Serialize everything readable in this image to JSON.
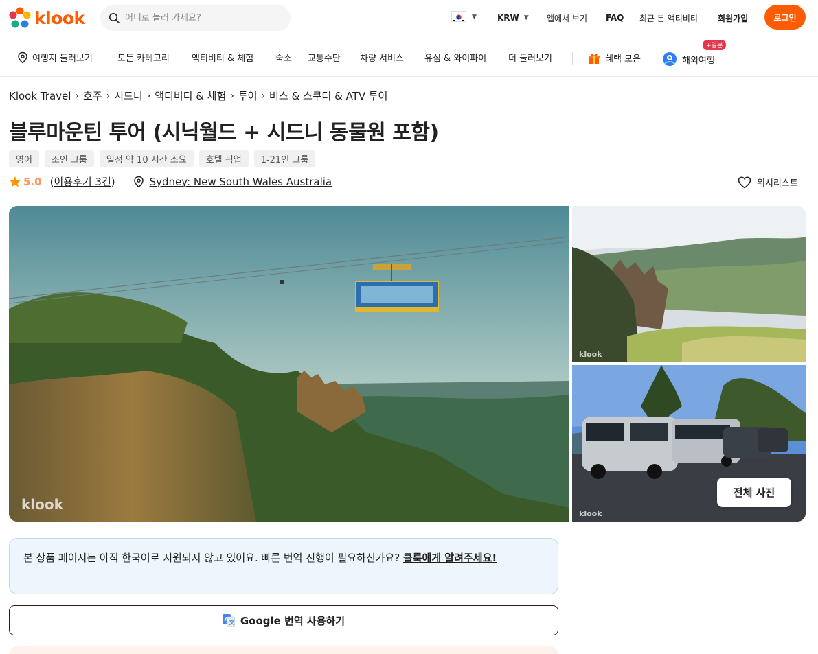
{
  "header": {
    "logo_text": "klook",
    "search_placeholder": "어디로 놀러 가세요?",
    "currency": "KRW",
    "app_view": "앱에서 보기",
    "faq": "FAQ",
    "recent": "최근 본 액티비티",
    "signup": "회원가입",
    "login": "로그인"
  },
  "nav": {
    "items": [
      "여행지 둘러보기",
      "모든 카테고리",
      "액티비티 & 체험",
      "숙소",
      "교통수단",
      "차량 서비스",
      "유심 & 와이파이",
      "더 둘러보기"
    ],
    "benefits": "혜택 모음",
    "overseas": "해외여행",
    "overseas_badge": "+일본"
  },
  "breadcrumb": [
    "Klook Travel",
    "호주",
    "시드니",
    "액티비티 & 체험",
    "투어",
    "버스 & 스쿠터 & ATV 투어"
  ],
  "title": "블루마운틴 투어 (시닉월드 + 시드니 동물원 포함)",
  "tags": [
    "영어",
    "조인 그룹",
    "일정 약 10 시간  소요",
    "호텔 픽업",
    "1-21인 그룹"
  ],
  "rating": {
    "value": "5.0",
    "reviews_open": "(",
    "reviews": "이용후기 3건",
    "reviews_close": ")",
    "location": "Sydney: New South Wales Australia"
  },
  "wishlist": "위시리스트",
  "gallery": {
    "watermark": "klook",
    "all_photos": "전체 사진"
  },
  "notice": {
    "text": "본 상품 페이지는 아직 한국어로 지원되지 않고 있어요. 빠른 번역 진행이 필요하신가요? ",
    "link": "클룩에게 알려주세요!"
  },
  "translate_button": "Google 번역 사용하기",
  "colors": {
    "brand": "#ff5b00",
    "star": "#ff9557",
    "notice_bg": "#eef5fd"
  }
}
